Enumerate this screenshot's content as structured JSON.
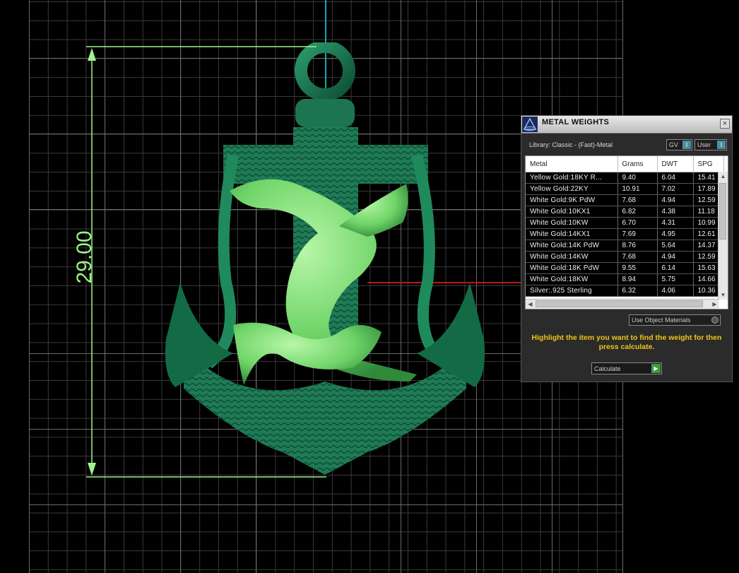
{
  "dimension": {
    "value": "29.00"
  },
  "panel": {
    "title": "METAL WEIGHTS",
    "close": "×",
    "library": "Library: Classic - (Fast)-Metal",
    "toggle_gv": "GV",
    "toggle_user": "User",
    "toggle_glyph": "I",
    "columns": [
      "Metal",
      "Grams",
      "DWT",
      "SPG"
    ],
    "rows": [
      [
        "Yellow Gold:18KY R...",
        "9.40",
        "6.04",
        "15.41"
      ],
      [
        "Yellow Gold:22KY",
        "10.91",
        "7.02",
        "17.89"
      ],
      [
        "White Gold:9K PdW",
        "7.68",
        "4.94",
        "12.59"
      ],
      [
        "White Gold:10KX1",
        "6.82",
        "4.38",
        "11.18"
      ],
      [
        "White Gold:10KW",
        "6.70",
        "4.31",
        "10.99"
      ],
      [
        "White Gold:14KX1",
        "7.69",
        "4.95",
        "12.61"
      ],
      [
        "White Gold:14K PdW",
        "8.76",
        "5.64",
        "14.37"
      ],
      [
        "White Gold:14KW",
        "7.68",
        "4.94",
        "12.59"
      ],
      [
        "White Gold:18K PdW",
        "9.55",
        "6.14",
        "15.63"
      ],
      [
        "White Gold:18KW",
        "8.94",
        "5.75",
        "14.66"
      ],
      [
        "Silver:.925 Sterling",
        "6.32",
        "4.06",
        "10.36"
      ]
    ],
    "use_object_materials": "Use Object Materials",
    "hint": "Highlight the item you want to find the weight for then press calculate.",
    "calculate": "Calculate",
    "calculate_glyph": "▶"
  },
  "colors": {
    "model_dark": "#1f7a55",
    "model_light": "#7fe07a",
    "dimension": "#9ff28a",
    "axis": "#17a6b0",
    "section": "#c0141a",
    "hint": "#f0c419"
  }
}
